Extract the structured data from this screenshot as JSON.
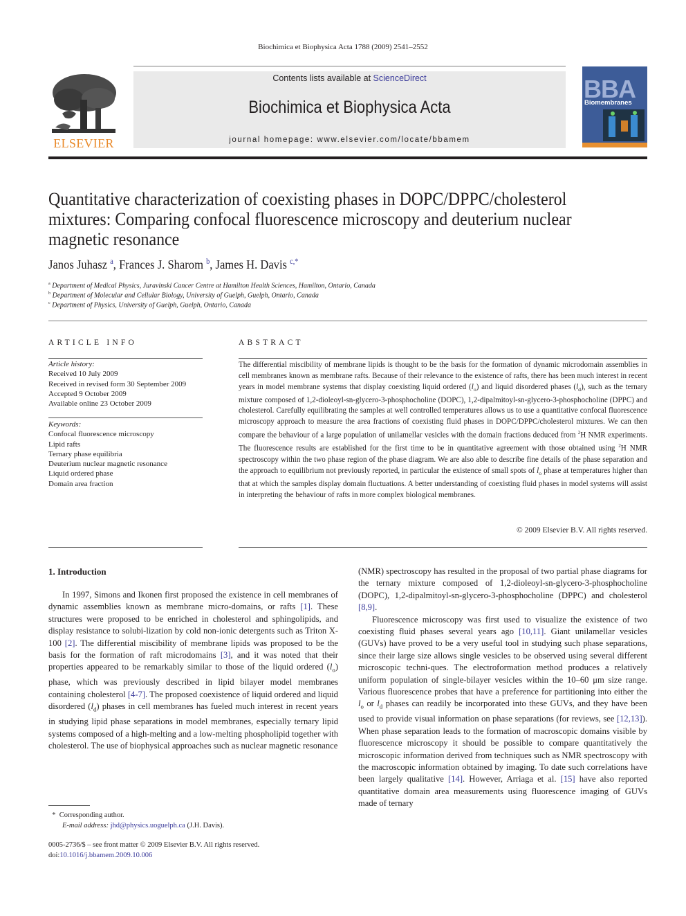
{
  "running_header": "Biochimica et Biophysica Acta 1788 (2009) 2541–2552",
  "masthead": {
    "publisher_logo_text": "ELSEVIER",
    "contents_prefix": "Contents lists available at ",
    "contents_link": "ScienceDirect",
    "journal_name": "Biochimica et Biophysica Acta",
    "homepage_line": "journal homepage: www.elsevier.com/locate/bbamem",
    "cover": {
      "title": "BBA",
      "subtitle": "Biomembranes"
    },
    "colors": {
      "band": "#eaeaea",
      "elsevier_orange": "#e98a2b",
      "cover_blue": "#3d5c98",
      "link": "#3a3a9a"
    }
  },
  "article": {
    "title": "Quantitative characterization of coexisting phases in DOPC/DPPC/cholesterol mixtures: Comparing confocal fluorescence microscopy and deuterium nuclear magnetic resonance",
    "authors": [
      {
        "name": "Janos Juhasz",
        "sup": "a"
      },
      {
        "name": "Frances J. Sharom",
        "sup": "b"
      },
      {
        "name": "James H. Davis",
        "sup": "c,*"
      }
    ],
    "affiliations": [
      {
        "sup": "a",
        "text": "Department of Medical Physics, Juravinski Cancer Centre at Hamilton Health Sciences, Hamilton, Ontario, Canada"
      },
      {
        "sup": "b",
        "text": "Department of Molecular and Cellular Biology, University of Guelph, Guelph, Ontario, Canada"
      },
      {
        "sup": "c",
        "text": "Department of Physics, University of Guelph, Guelph, Ontario, Canada"
      }
    ]
  },
  "article_info": {
    "heading": "ARTICLE INFO",
    "history_label": "Article history:",
    "history": [
      "Received 10 July 2009",
      "Received in revised form 30 September 2009",
      "Accepted 9 October 2009",
      "Available online 23 October 2009"
    ],
    "keywords_label": "Keywords:",
    "keywords": [
      "Confocal fluorescence microscopy",
      "Lipid rafts",
      "Ternary phase equilibria",
      "Deuterium nuclear magnetic resonance",
      "Liquid ordered phase",
      "Domain area fraction"
    ]
  },
  "abstract": {
    "heading": "ABSTRACT",
    "parts": {
      "p1": "The differential miscibility of membrane lipids is thought to be the basis for the formation of dynamic microdomain assemblies in cell membranes known as membrane rafts. Because of their relevance to the existence of rafts, there has been much interest in recent years in model membrane systems that display coexisting liquid ordered (",
      "lo": "l",
      "lo_sub": "o",
      "p2": ") and liquid disordered phases (",
      "ld": "l",
      "ld_sub": "d",
      "p3": "), such as the ternary mixture composed of 1,2-dioleoyl-sn-glycero-3-phosphocholine (DOPC), 1,2-dipalmitoyl-sn-glycero-3-phosphocholine (DPPC) and cholesterol. Carefully equilibrating the samples at well controlled temperatures allows us to use a quantitative confocal fluorescence microscopy approach to measure the area fractions of coexisting fluid phases in DOPC/DPPC/cholesterol mixtures. We can then compare the behaviour of a large population of unilamellar vesicles with the domain fractions deduced from ",
      "iso": "2",
      "p4": "H NMR experiments. The fluorescence results are established for the first time to be in quantitative agreement with those obtained using ",
      "p5": "H NMR spectroscopy within the two phase region of the phase diagram. We are also able to describe fine details of the phase separation and the approach to equilibrium not previously reported, in particular the existence of small spots of ",
      "p6": " phase at temperatures higher than that at which the samples display domain fluctuations. A better understanding of coexisting fluid phases in model systems will assist in interpreting the behaviour of rafts in more complex biological membranes."
    },
    "copyright": "© 2009 Elsevier B.V. All rights reserved."
  },
  "body": {
    "section_heading": "1. Introduction",
    "col1": {
      "a": "In 1997, Simons and Ikonen first proposed the existence in cell membranes of dynamic assemblies known as membrane micro-domains, or rafts ",
      "ref1": "[1]",
      "b": ". These structures were proposed to be enriched in cholesterol and sphingolipids, and display resistance to solubi-lization by cold non-ionic detergents such as Triton X-100 ",
      "ref2": "[2]",
      "c": ". The differential miscibility of membrane lipids was proposed to be the basis for the formation of raft microdomains ",
      "ref3": "[3]",
      "d": ", and it was noted that their properties appeared to be remarkably similar to those of the liquid ordered (",
      "e": ") phase, which was previously described in lipid bilayer model membranes containing cholesterol ",
      "ref4": "[4-7]",
      "f": ". The proposed coexistence of liquid ordered and liquid disordered (",
      "g": ") phases in cell membranes has fueled much interest in recent years in studying lipid phase separations in model membranes, especially ternary lipid systems composed of a high-melting and a low-melting phospholipid together with cholesterol. The use of biophysical approaches such as nuclear magnetic resonance"
    },
    "col2": {
      "a": "(NMR) spectroscopy has resulted in the proposal of two partial phase diagrams for the ternary mixture composed of 1,2-dioleoyl-sn-glycero-3-phosphocholine (DOPC), 1,2-dipalmitoyl-sn-glycero-3-phosphocholine (DPPC) and cholesterol ",
      "ref89": "[8,9]",
      "a_end": ".",
      "b": "Fluorescence microscopy was first used to visualize the existence of two coexisting fluid phases several years ago ",
      "ref1011": "[10,11]",
      "c": ". Giant unilamellar vesicles (GUVs) have proved to be a very useful tool in studying such phase separations, since their large size allows single vesicles to be observed using several different microscopic techni-ques. The electroformation method produces a relatively uniform population of single-bilayer vesicles within the 10–60 μm size range. Various fluorescence probes that have a preference for partitioning into either the ",
      "or": " or ",
      "d": " phases can readily be incorporated into these GUVs, and they have been used to provide visual information on phase separations (for reviews, see ",
      "ref1213": "[12,13]",
      "e": "). When phase separation leads to the formation of macroscopic domains visible by fluorescence microscopy it should be possible to compare quantitatively the microscopic information derived from techniques such as NMR spectroscopy with the macroscopic information obtained by imaging. To date such correlations have been largely qualitative ",
      "ref14": "[14]",
      "f": ". However, Arriaga et al. ",
      "ref15": "[15]",
      "g": " have also reported quantitative domain area measurements using fluorescence imaging of GUVs made of ternary"
    }
  },
  "footnote": {
    "star": "*",
    "corresponding": "Corresponding author.",
    "email_label": "E-mail address:",
    "email": "jhd@physics.uoguelph.ca",
    "email_suffix": " (J.H. Davis)."
  },
  "front_matter": {
    "issn_line": "0005-2736/$ – see front matter © 2009 Elsevier B.V. All rights reserved.",
    "doi_prefix": "doi:",
    "doi": "10.1016/j.bbamem.2009.10.006"
  }
}
